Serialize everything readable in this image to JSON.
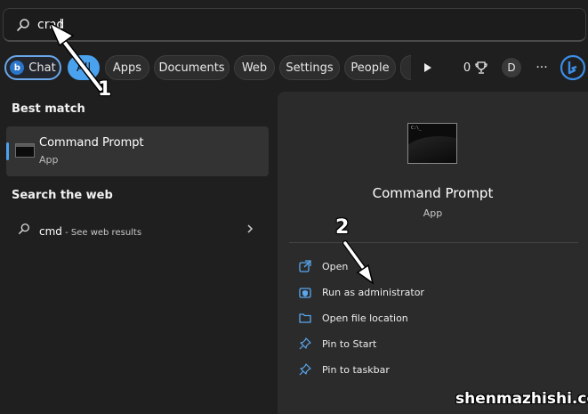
{
  "search": {
    "value": "cmd",
    "placeholder": ""
  },
  "chips": {
    "chat": "Chat",
    "all": "All",
    "apps": "Apps",
    "documents": "Documents",
    "web": "Web",
    "settings": "Settings",
    "people": "People"
  },
  "toolbar": {
    "points": "0",
    "profile_initial": "D",
    "more": "···"
  },
  "left": {
    "best_match_heading": "Best match",
    "best_match": {
      "title": "Command Prompt",
      "subtitle": "App"
    },
    "web_heading": "Search the web",
    "web_result": {
      "query": "cmd",
      "suffix": " - See web results"
    }
  },
  "right": {
    "title": "Command Prompt",
    "subtitle": "App",
    "actions": [
      {
        "label": "Open",
        "icon": "open-icon"
      },
      {
        "label": "Run as administrator",
        "icon": "shield-icon"
      },
      {
        "label": "Open file location",
        "icon": "folder-icon"
      },
      {
        "label": "Pin to Start",
        "icon": "pin-icon"
      },
      {
        "label": "Pin to taskbar",
        "icon": "pin-icon"
      }
    ]
  },
  "annotations": {
    "step1": "1",
    "step2": "2"
  },
  "watermark": "shenmazhishi.com",
  "colors": {
    "accent": "#4aa2ef",
    "background": "#1f1f1f",
    "panel": "#2b2b2b"
  }
}
